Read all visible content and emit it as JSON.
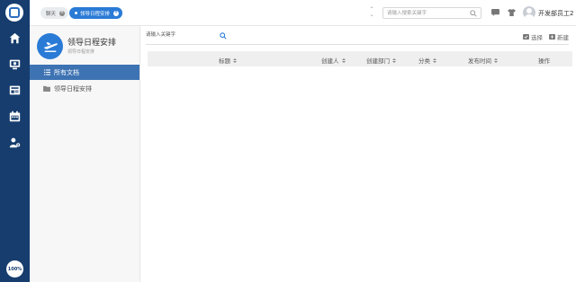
{
  "rail": {
    "items": [
      {
        "icon": "home-icon"
      },
      {
        "icon": "video-meeting-icon"
      },
      {
        "icon": "news-icon"
      },
      {
        "icon": "calendar-icon"
      },
      {
        "icon": "user-settings-icon"
      }
    ],
    "zoom": "100%"
  },
  "tabs": [
    {
      "label": "聊天"
    },
    {
      "label": "领导日程安排"
    }
  ],
  "header": {
    "search_placeholder": "请输入搜索关键字",
    "username": "开发部员工2"
  },
  "sidebar": {
    "app_title": "领导日程安排",
    "app_subtitle": "领导日程安排",
    "items": [
      {
        "label": "所有文档",
        "active": true
      },
      {
        "label": "领导日程安排",
        "active": false
      }
    ]
  },
  "main": {
    "keyword_placeholder": "请输入关键字",
    "actions": {
      "select": "选择",
      "new": "新建"
    },
    "columns": [
      "标题",
      "创建人",
      "创建部门",
      "分类",
      "发布时间",
      "操作"
    ]
  },
  "colors": {
    "rail_bg": "#163d6e",
    "accent": "#2a7bd6",
    "active_menu": "#3e73b3"
  }
}
